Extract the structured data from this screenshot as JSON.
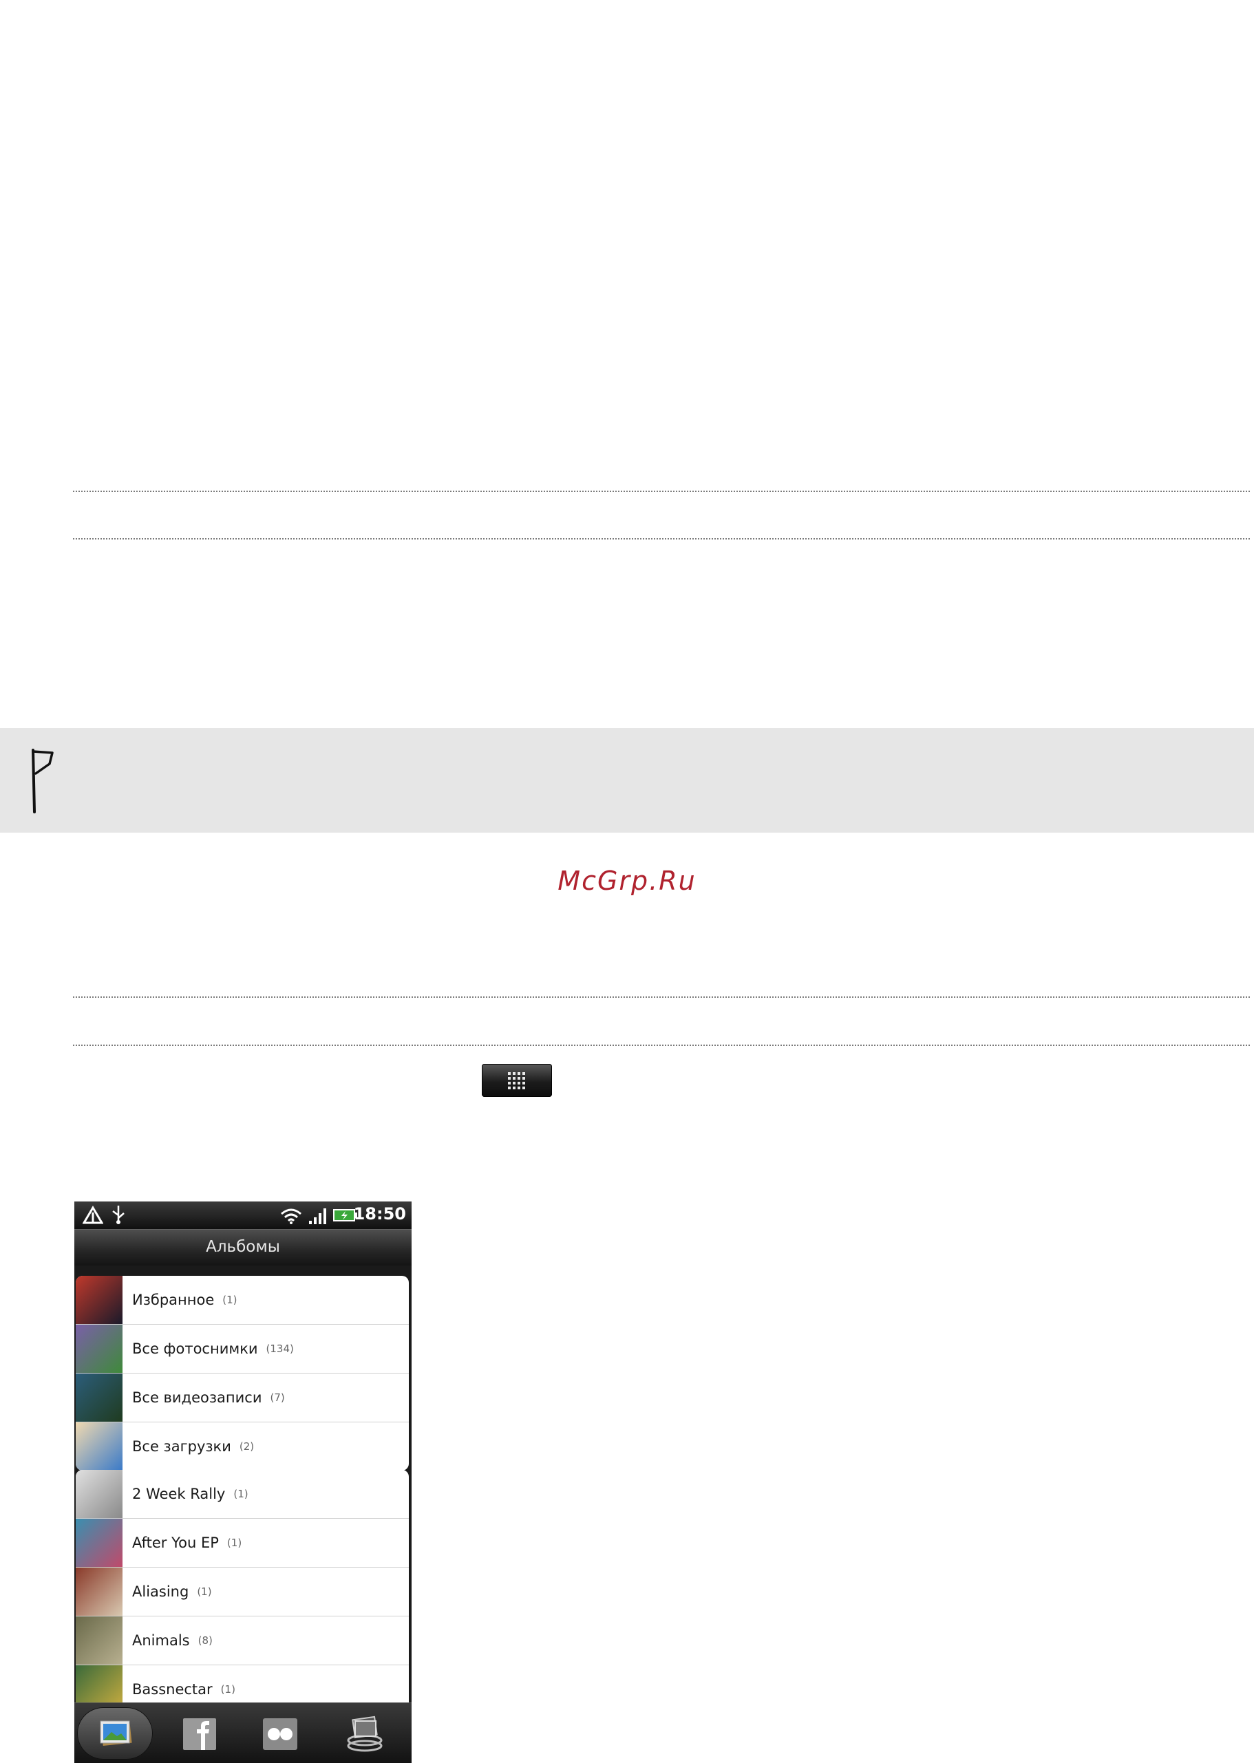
{
  "watermark": "McGrp.Ru",
  "phone": {
    "status": {
      "time": "18:50"
    },
    "title": "Альбомы",
    "groups": [
      [
        {
          "label": "Избранное",
          "count": "(1)",
          "colors": [
            "#c0392b",
            "#1a1a2a"
          ]
        },
        {
          "label": "Все фотоснимки",
          "count": "(134)",
          "colors": [
            "#7a5fa8",
            "#3f8a3a"
          ]
        },
        {
          "label": "Все видеозаписи",
          "count": "(7)",
          "colors": [
            "#2c5d7a",
            "#1f3b1f"
          ]
        },
        {
          "label": "Все загрузки",
          "count": "(2)",
          "colors": [
            "#f0d9b0",
            "#3a7ac8"
          ]
        }
      ],
      [
        {
          "label": "2 Week Rally",
          "count": "(1)",
          "colors": [
            "#e0e0e0",
            "#8a8a8a"
          ]
        },
        {
          "label": "After You EP",
          "count": "(1)",
          "colors": [
            "#3a8fb0",
            "#c04a6a"
          ]
        },
        {
          "label": "Aliasing",
          "count": "(1)",
          "colors": [
            "#8a3a2a",
            "#d8c8b0"
          ]
        },
        {
          "label": "Animals",
          "count": "(8)",
          "colors": [
            "#6a6a4a",
            "#b8b090"
          ]
        },
        {
          "label": "Bassnectar",
          "count": "(1)",
          "colors": [
            "#3a6a3a",
            "#d0b040"
          ]
        }
      ]
    ],
    "tabs": [
      "gallery-tab",
      "facebook-tab",
      "flickr-tab",
      "albums-stack-tab"
    ]
  }
}
